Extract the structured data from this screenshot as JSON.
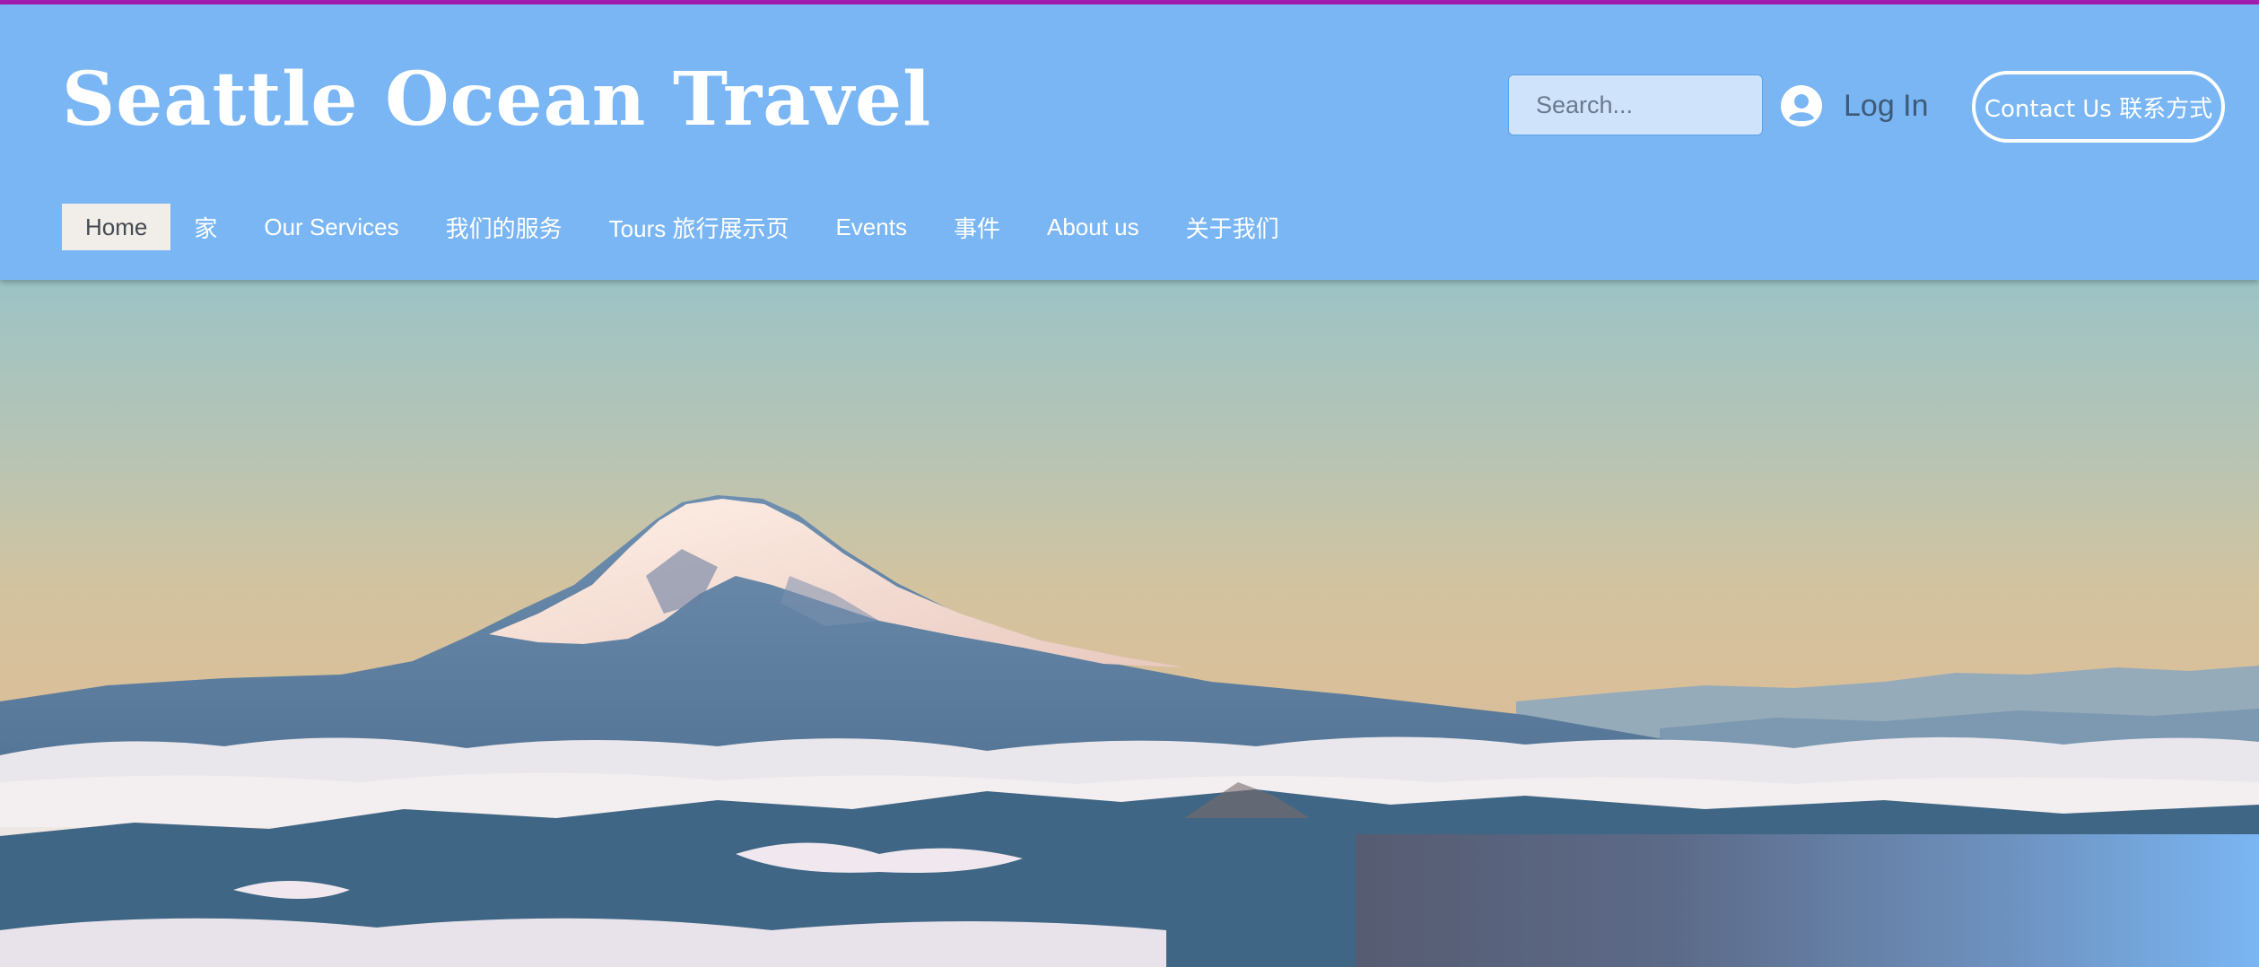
{
  "header": {
    "site_title": "Seattle Ocean Travel",
    "search": {
      "placeholder": "Search..."
    },
    "login_label": "Log In",
    "contact_label": "Contact Us 联系方式"
  },
  "nav": {
    "items": [
      {
        "label": "Home",
        "active": true
      },
      {
        "label": "家"
      },
      {
        "label": "Our Services"
      },
      {
        "label": "我们的服务"
      },
      {
        "label": "Tours 旅行展示页"
      },
      {
        "label": "Events"
      },
      {
        "label": "事件"
      },
      {
        "label": "About us"
      },
      {
        "label": "关于我们"
      }
    ]
  },
  "icons": {
    "search": "search-icon",
    "login": "avatar-icon"
  },
  "colors": {
    "header_bg": "#7ab6f3",
    "accent_bar": "#a21caf",
    "search_button": "#4fa6ec",
    "active_nav_bg": "#f1ede8"
  }
}
